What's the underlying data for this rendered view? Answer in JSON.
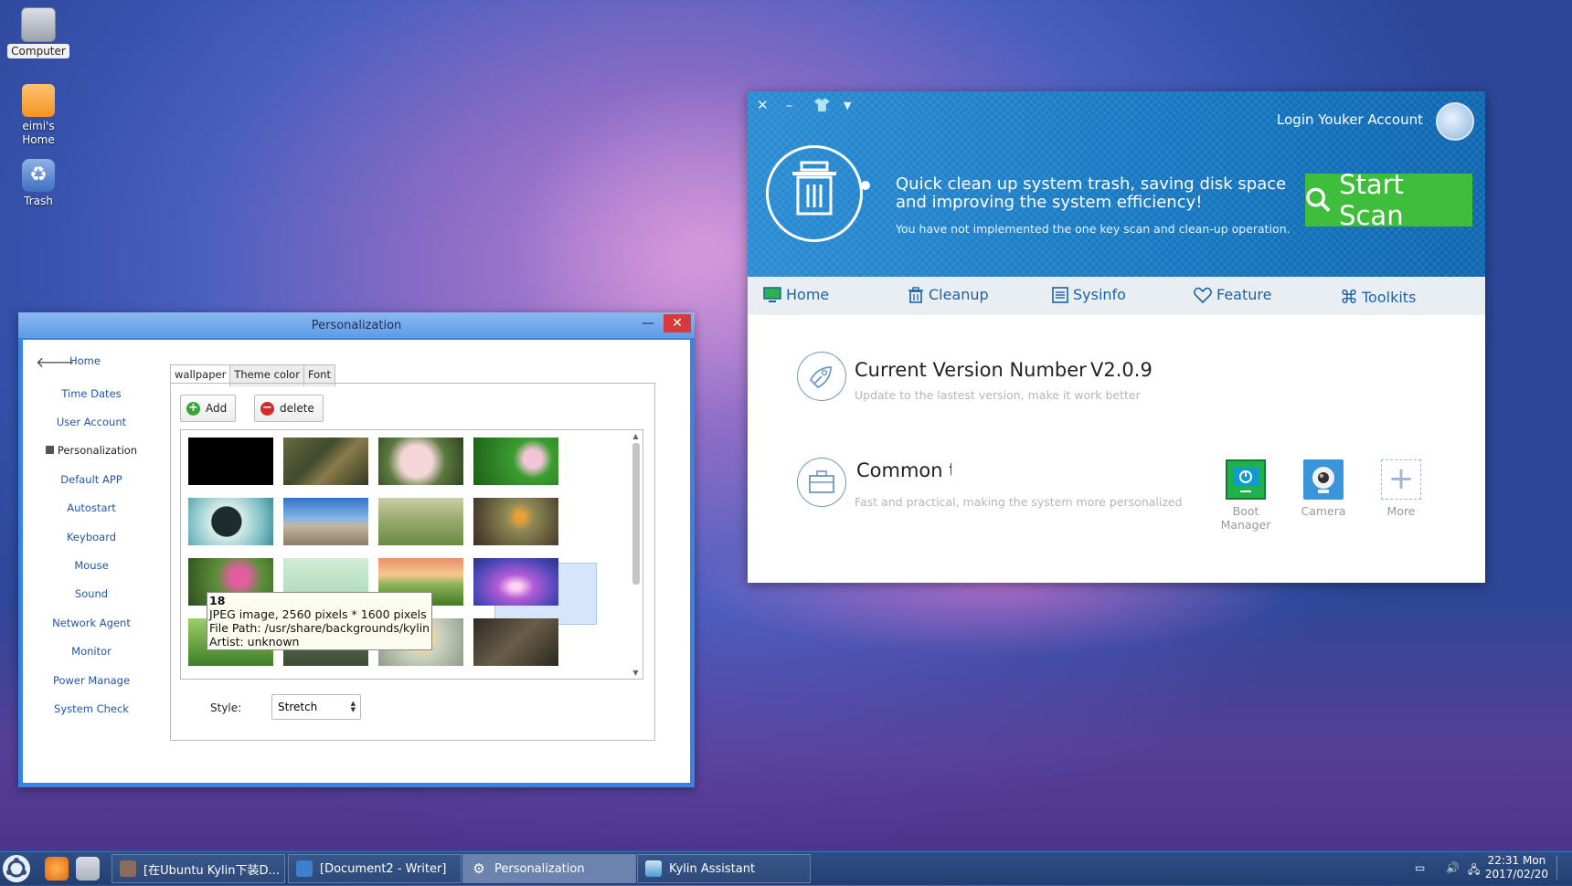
{
  "desktop": {
    "icons": [
      {
        "label": "Computer"
      },
      {
        "label": "eimi's Home"
      },
      {
        "label": "Trash"
      }
    ]
  },
  "personalization": {
    "title": "Personalization",
    "sidebar": {
      "home": "Home",
      "items": [
        "Time Dates",
        "User Account",
        "Personalization",
        "Default APP",
        "Autostart",
        "Keyboard",
        "Mouse",
        "Sound",
        "Network Agent",
        "Monitor",
        "Power Manage",
        "System Check"
      ],
      "active": "Personalization"
    },
    "tabs": [
      "wallpaper",
      "Theme color",
      "Font"
    ],
    "active_tab": "wallpaper",
    "add_label": "Add",
    "delete_label": "delete",
    "tooltip": {
      "name": "18",
      "type": "JPEG image, 2560 pixels * 1600 pixels",
      "path": "File Path: /usr/share/backgrounds/kylin",
      "artist": "Artist: unknown"
    },
    "style_label": "Style:",
    "style_value": "Stretch"
  },
  "kylin": {
    "login": "Login Youker Account",
    "headline": "Quick clean up system trash, saving disk space and improving the system efficiency!",
    "subline": "You have not implemented the one key scan and clean-up operation.",
    "scan_button": "Start Scan",
    "nav": [
      "Home",
      "Cleanup",
      "Sysinfo",
      "Feature",
      "Toolkits"
    ],
    "version_title": "Current Version Number",
    "version_number": "V2.0.9",
    "version_sub": "Update to the lastest version, make it work better",
    "tools_title": "Common t",
    "tools_sub": "Fast and practical, making the system more personalized",
    "tools": [
      {
        "label": "Boot Manager",
        "icon": "power-monitor-icon",
        "color": "#1fb24c"
      },
      {
        "label": "Camera",
        "icon": "webcam-icon",
        "color": "#3a96d8"
      },
      {
        "label": "More",
        "icon": "plus-icon",
        "color": "#9ab6d8"
      }
    ]
  },
  "taskbar": {
    "tasks": [
      "[在Ubuntu Kylin下装D...",
      "[Document2 - Writer]",
      "Personalization",
      "Kylin Assistant"
    ],
    "active_task": "Personalization",
    "clock_time": "22:31 Mon",
    "clock_date": "2017/02/20"
  }
}
